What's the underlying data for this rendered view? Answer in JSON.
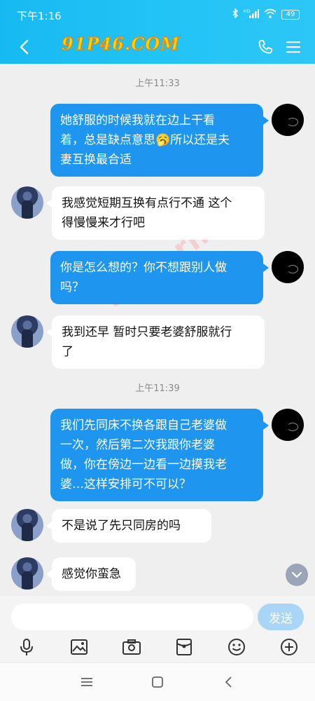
{
  "status_bar": {
    "time": "下午1:16",
    "battery": "49",
    "signal_label": "HD"
  },
  "header": {
    "title": "91P46.COM"
  },
  "watermark": "91porn.om",
  "messages": [
    {
      "kind": "time",
      "text": "上午11:33"
    },
    {
      "kind": "out",
      "lines": [
        "她舒服的时候我就在边上干看",
        "着，总是缺点意思🥱所以还是夫",
        "妻互换最合适"
      ]
    },
    {
      "kind": "in",
      "lines": [
        "我感觉短期互换有点行不通  这个",
        "得慢慢来才行吧"
      ]
    },
    {
      "kind": "out",
      "lines": [
        "你是怎么想的？你不想跟别人做",
        "吗？"
      ]
    },
    {
      "kind": "in",
      "lines": [
        "我到还早  暂时只要老婆舒服就行",
        "了"
      ]
    },
    {
      "kind": "time",
      "text": "上午11:39"
    },
    {
      "kind": "out",
      "lines": [
        "我们先同床不换各跟自己老婆做",
        "一次，然后第二次我跟你老婆",
        "做，你在傍边一边看一边摸我老",
        "婆…这样安排可不可以？"
      ]
    },
    {
      "kind": "in",
      "lines": [
        "不是说了先只同房的吗"
      ]
    },
    {
      "kind": "in",
      "lines": [
        "感觉你蛮急"
      ]
    }
  ],
  "input": {
    "placeholder": "",
    "send_label": "发送"
  },
  "toolbar": [
    "microphone-icon",
    "image-icon",
    "camera-icon",
    "red-packet-icon",
    "emoji-icon",
    "plus-icon"
  ],
  "colors": {
    "header": "#22c4f5",
    "out_bubble": "#1e96ef",
    "in_bubble": "#ffffff",
    "background": "#efefef",
    "send_disabled": "#a9d5f6"
  }
}
